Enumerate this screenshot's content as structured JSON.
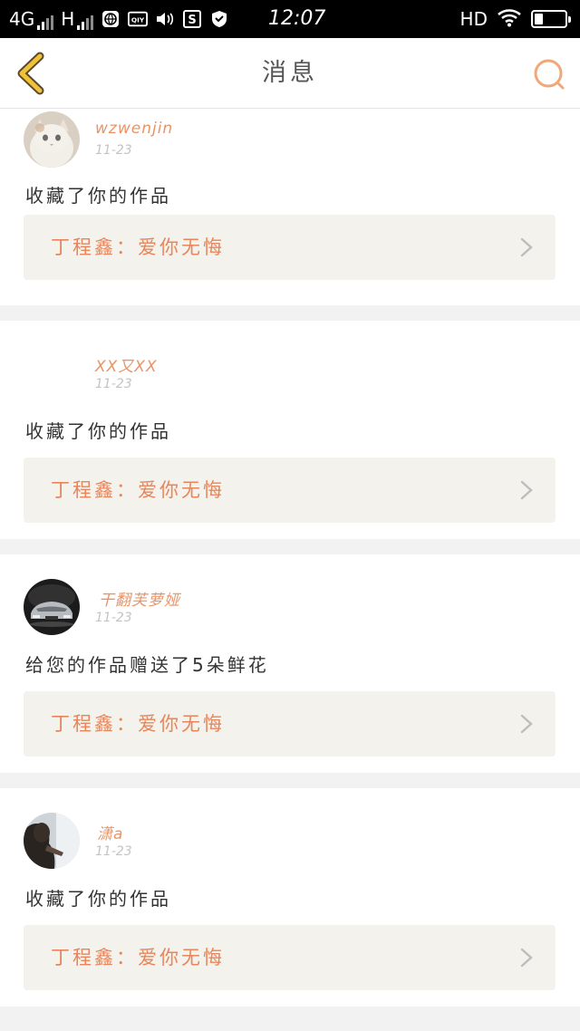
{
  "status_bar": {
    "network": "4G",
    "network2": "H",
    "time": "12:07",
    "hd": "HD"
  },
  "header": {
    "title": "消息"
  },
  "notifications": [
    {
      "user": "wzwenjin",
      "date": "11-23",
      "action": "收藏了你的作品",
      "work": "丁程鑫：爱你无悔",
      "avatar": "cat-photo"
    },
    {
      "user": "XX又XX",
      "date": "11-23",
      "action": "收藏了你的作品",
      "work": "丁程鑫：爱你无悔",
      "avatar": "none"
    },
    {
      "user": "干翻芙萝娅",
      "date": "11-23",
      "action": "给您的作品赠送了5朵鲜花",
      "work": "丁程鑫：爱你无悔",
      "avatar": "car-photo"
    },
    {
      "user": "潇a",
      "date": "11-23",
      "action": "收藏了你的作品",
      "work": "丁程鑫：爱你无悔",
      "avatar": "person-photo"
    }
  ],
  "colors": {
    "accent": "#e8855a",
    "back_arrow": "#f0c23a",
    "card_bg": "#f3f2ec"
  }
}
